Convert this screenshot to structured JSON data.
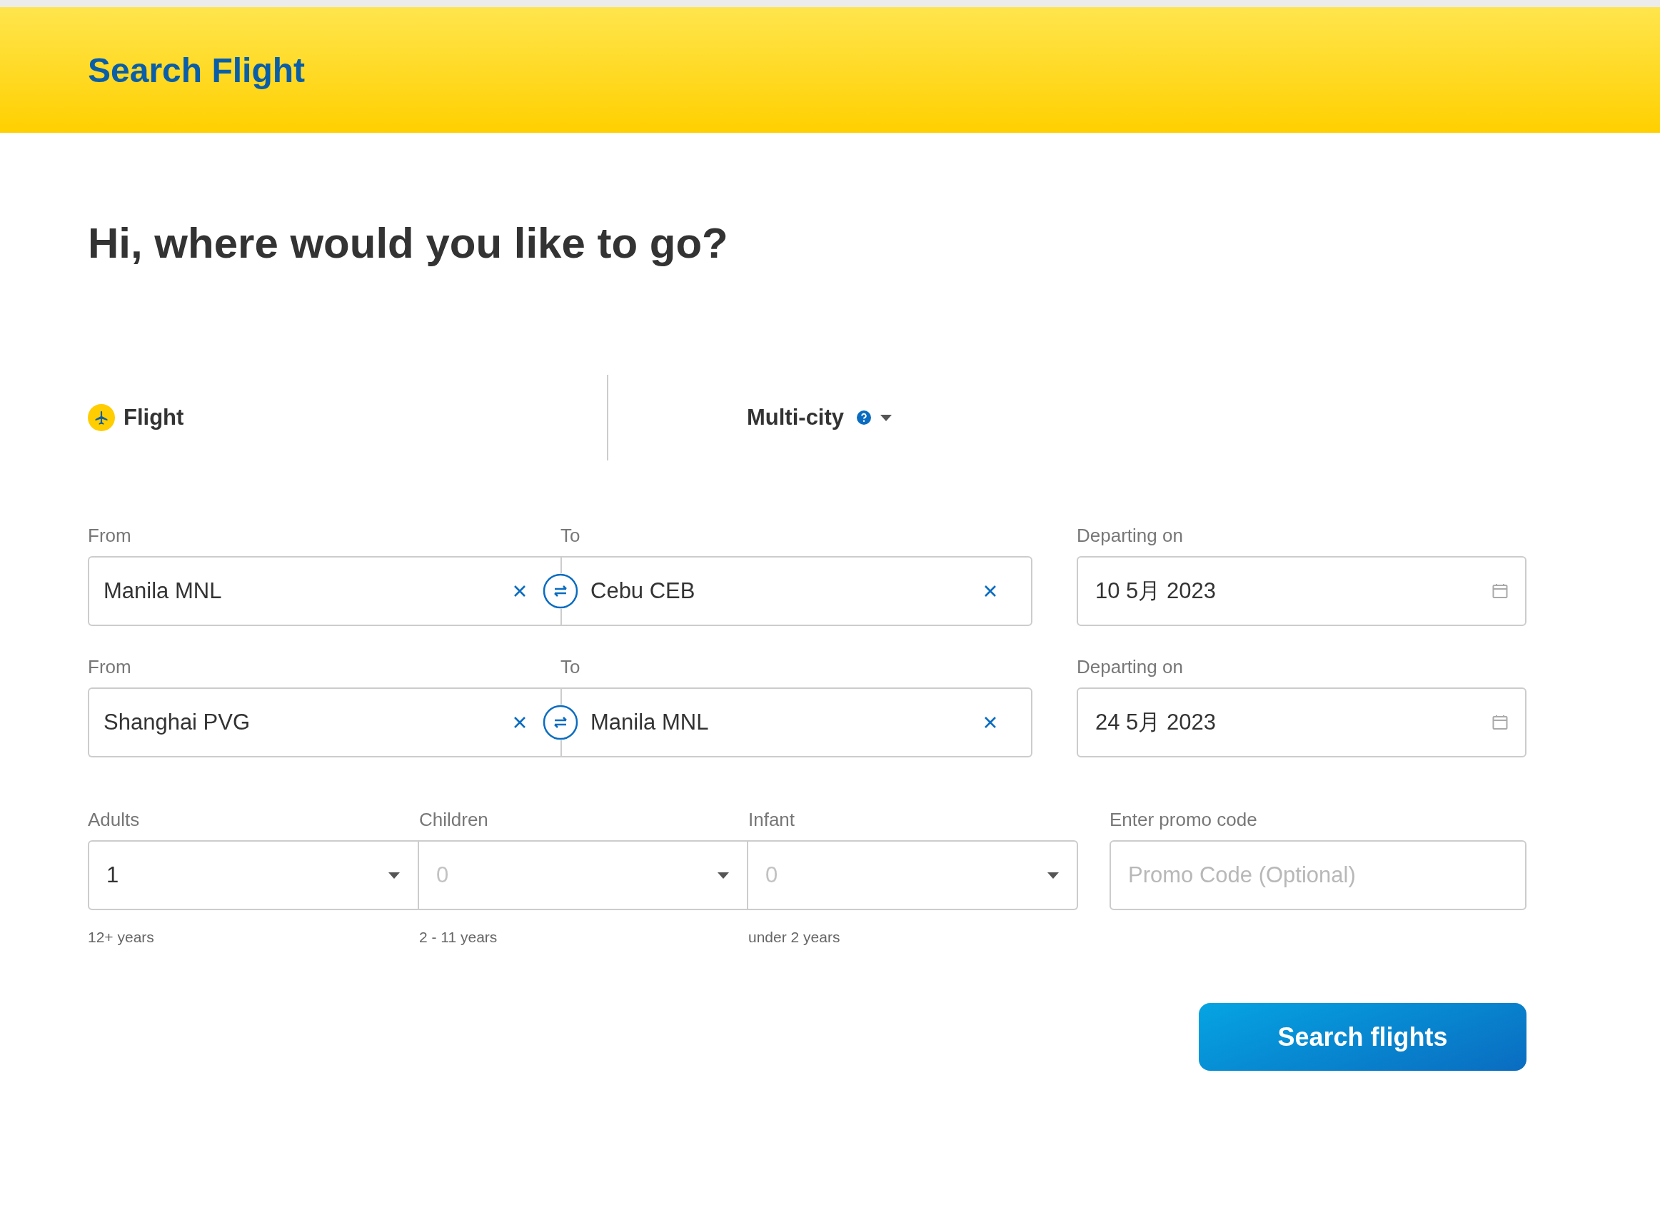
{
  "header": {
    "title": "Search Flight"
  },
  "heading": "Hi, where would you like to go?",
  "tabs": [
    {
      "label": "Flight",
      "selected": true,
      "has_menu": false
    },
    {
      "label": "Multi-city",
      "selected": false,
      "has_menu": true
    }
  ],
  "legs": [
    {
      "from_label": "From",
      "from": "Manila MNL",
      "to_label": "To",
      "to": "Cebu CEB",
      "date_label": "Departing on",
      "date": "10 5月 2023"
    },
    {
      "from_label": "From",
      "from": "Shanghai PVG",
      "to_label": "To",
      "to": "Manila MNL",
      "date_label": "Departing on",
      "date": "24 5月 2023"
    }
  ],
  "passengers": [
    {
      "label": "Adults",
      "value": "1",
      "hint": "12+ years",
      "disabled": false
    },
    {
      "label": "Children",
      "value": "0",
      "hint": "2 - 11 years",
      "disabled": true
    },
    {
      "label": "Infant",
      "value": "0",
      "hint": "under 2 years",
      "disabled": true
    }
  ],
  "promo": {
    "label": "Enter promo code",
    "placeholder": "Promo Code (Optional)"
  },
  "submit": "Search flights"
}
